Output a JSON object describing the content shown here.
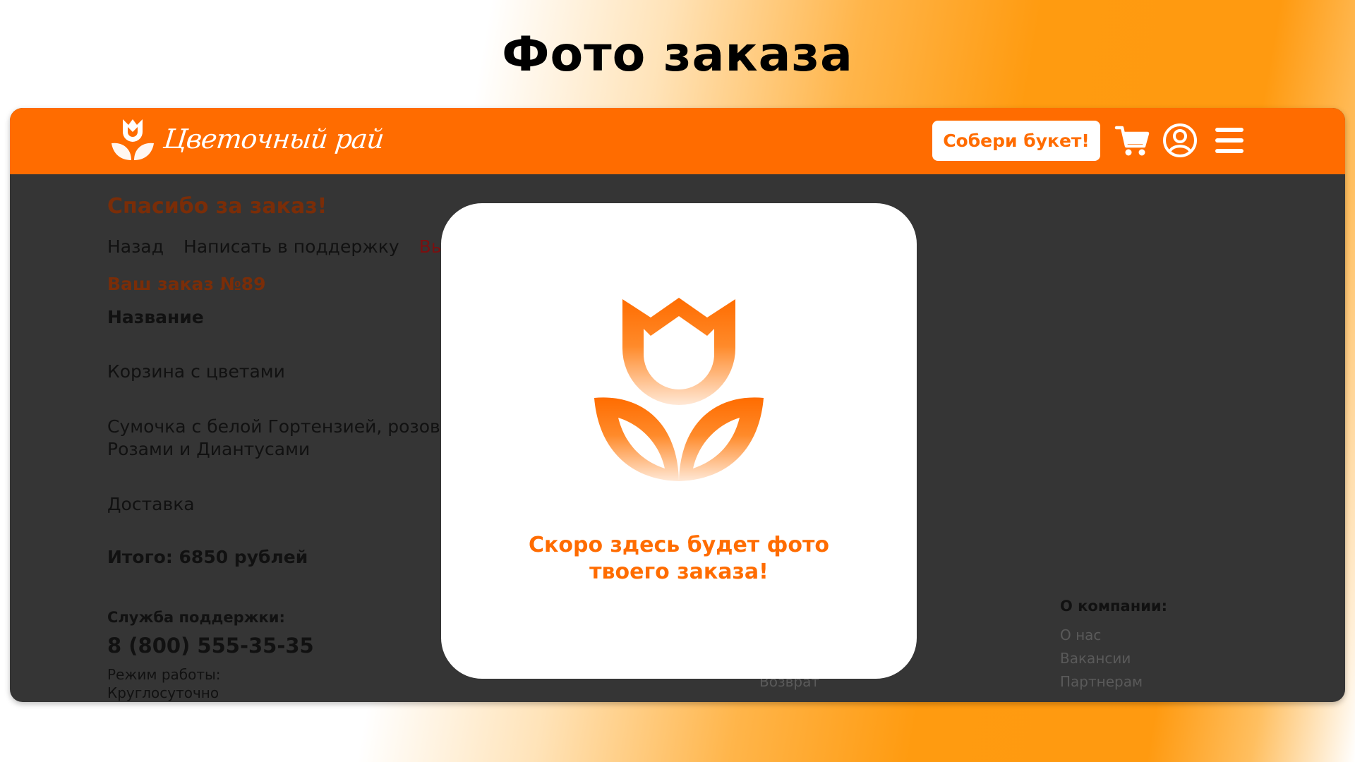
{
  "page_title": "Фото заказа",
  "header": {
    "brand": "Цветочный рай",
    "cta_label": "Собери букет!",
    "icons": [
      "cart-icon",
      "user-icon",
      "menu-icon"
    ]
  },
  "order": {
    "thanks": "Спасибо за заказ!",
    "nav": {
      "back": "Назад",
      "support": "Написать в поддержку",
      "logout": "Вых"
    },
    "number": "Ваш заказ №89",
    "column_name": "Название",
    "items": [
      "Корзина с цветами",
      "Сумочка с белой Гортензией, розовы",
      "Розами и Диантусами",
      "Доставка"
    ],
    "total": "Итого: 6850 рублей"
  },
  "footer": {
    "support_title": "Служба поддержки:",
    "phone": "8 (800) 555-35-35",
    "hours_label": "Режим работы:",
    "hours_value": "Круглосуточно",
    "middle_link": "Возврат",
    "company_title": "О компании:",
    "company_links": [
      "О нас",
      "Вакансии",
      "Партнерам"
    ]
  },
  "modal": {
    "line1": "Скоро здесь будет фото",
    "line2": "твоего заказа!"
  },
  "colors": {
    "accent": "#ff6c00",
    "dark_bg": "#353535",
    "brown": "#7a2d08"
  }
}
